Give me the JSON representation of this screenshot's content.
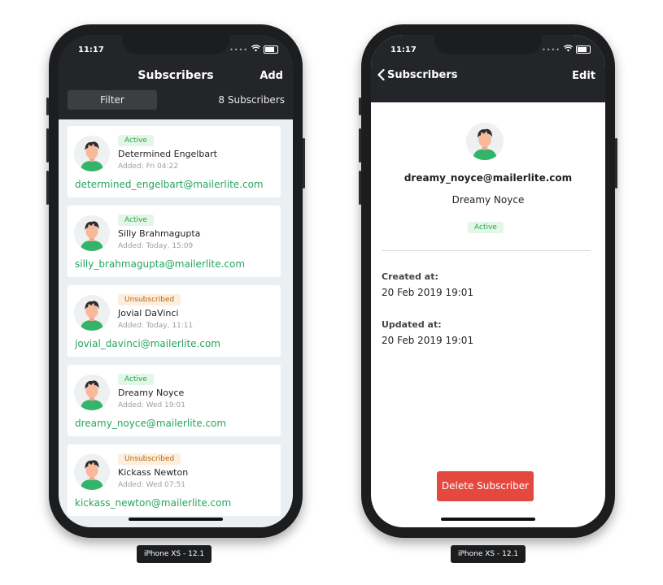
{
  "left_phone": {
    "status_time": "11:17",
    "nav_title": "Subscribers",
    "add_label": "Add",
    "filter_label": "Filter",
    "subscriber_count": "8 Subscribers",
    "subscribers": [
      {
        "status": "Active",
        "name": "Determined Engelbart",
        "added": "Added: Fri 04:22",
        "email": "determined_engelbart@mailerlite.com"
      },
      {
        "status": "Active",
        "name": "Silly Brahmagupta",
        "added": "Added: Today, 15:09",
        "email": "silly_brahmagupta@mailerlite.com"
      },
      {
        "status": "Unsubscribed",
        "name": "Jovial DaVinci",
        "added": "Added: Today, 11:11",
        "email": "jovial_davinci@mailerlite.com"
      },
      {
        "status": "Active",
        "name": "Dreamy Noyce",
        "added": "Added: Wed 19:01",
        "email": "dreamy_noyce@mailerlite.com"
      },
      {
        "status": "Unsubscribed",
        "name": "Kickass Newton",
        "added": "Added: Wed 07:51",
        "email": "kickass_newton@mailerlite.com"
      }
    ],
    "device_label": "iPhone XS - 12.1"
  },
  "right_phone": {
    "status_time": "11:17",
    "back_label": "Subscribers",
    "edit_label": "Edit",
    "email": "dreamy_noyce@mailerlite.com",
    "name": "Dreamy Noyce",
    "status": "Active",
    "created_label": "Created at:",
    "created_value": "20 Feb 2019 19:01",
    "updated_label": "Updated at:",
    "updated_value": "20 Feb 2019 19:01",
    "delete_label": "Delete Subscriber",
    "device_label": "iPhone XS - 12.1"
  },
  "colors": {
    "accent_green": "#25a55f",
    "active_badge_bg": "#e3f6e7",
    "unsubscribed_badge_bg": "#fdeedd",
    "delete_red": "#e5483f",
    "nav_dark": "#242528"
  }
}
